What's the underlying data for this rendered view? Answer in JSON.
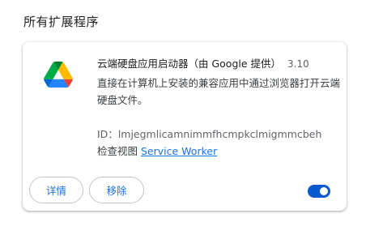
{
  "section": {
    "title": "所有扩展程序"
  },
  "extension": {
    "name": "云端硬盘应用启动器（由 Google 提供）",
    "version": "3.10",
    "description": "直接在计算机上安装的兼容应用中通过浏览器打开云端硬盘文件。",
    "id_label": "ID：",
    "id_value": "lmjegmlicamnimmfhcmpkclmigmmcbeh",
    "inspect_views_label": "检查视图",
    "inspect_views_link": "Service Worker",
    "icon": "google-drive-icon",
    "enabled": true
  },
  "buttons": {
    "details": "详情",
    "remove": "移除"
  },
  "colors": {
    "accent": "#1a73e8",
    "toggle_on": "#0b57d0",
    "drive_green": "#0f9d58",
    "drive_yellow": "#f4b400",
    "drive_blue": "#4285f4"
  }
}
